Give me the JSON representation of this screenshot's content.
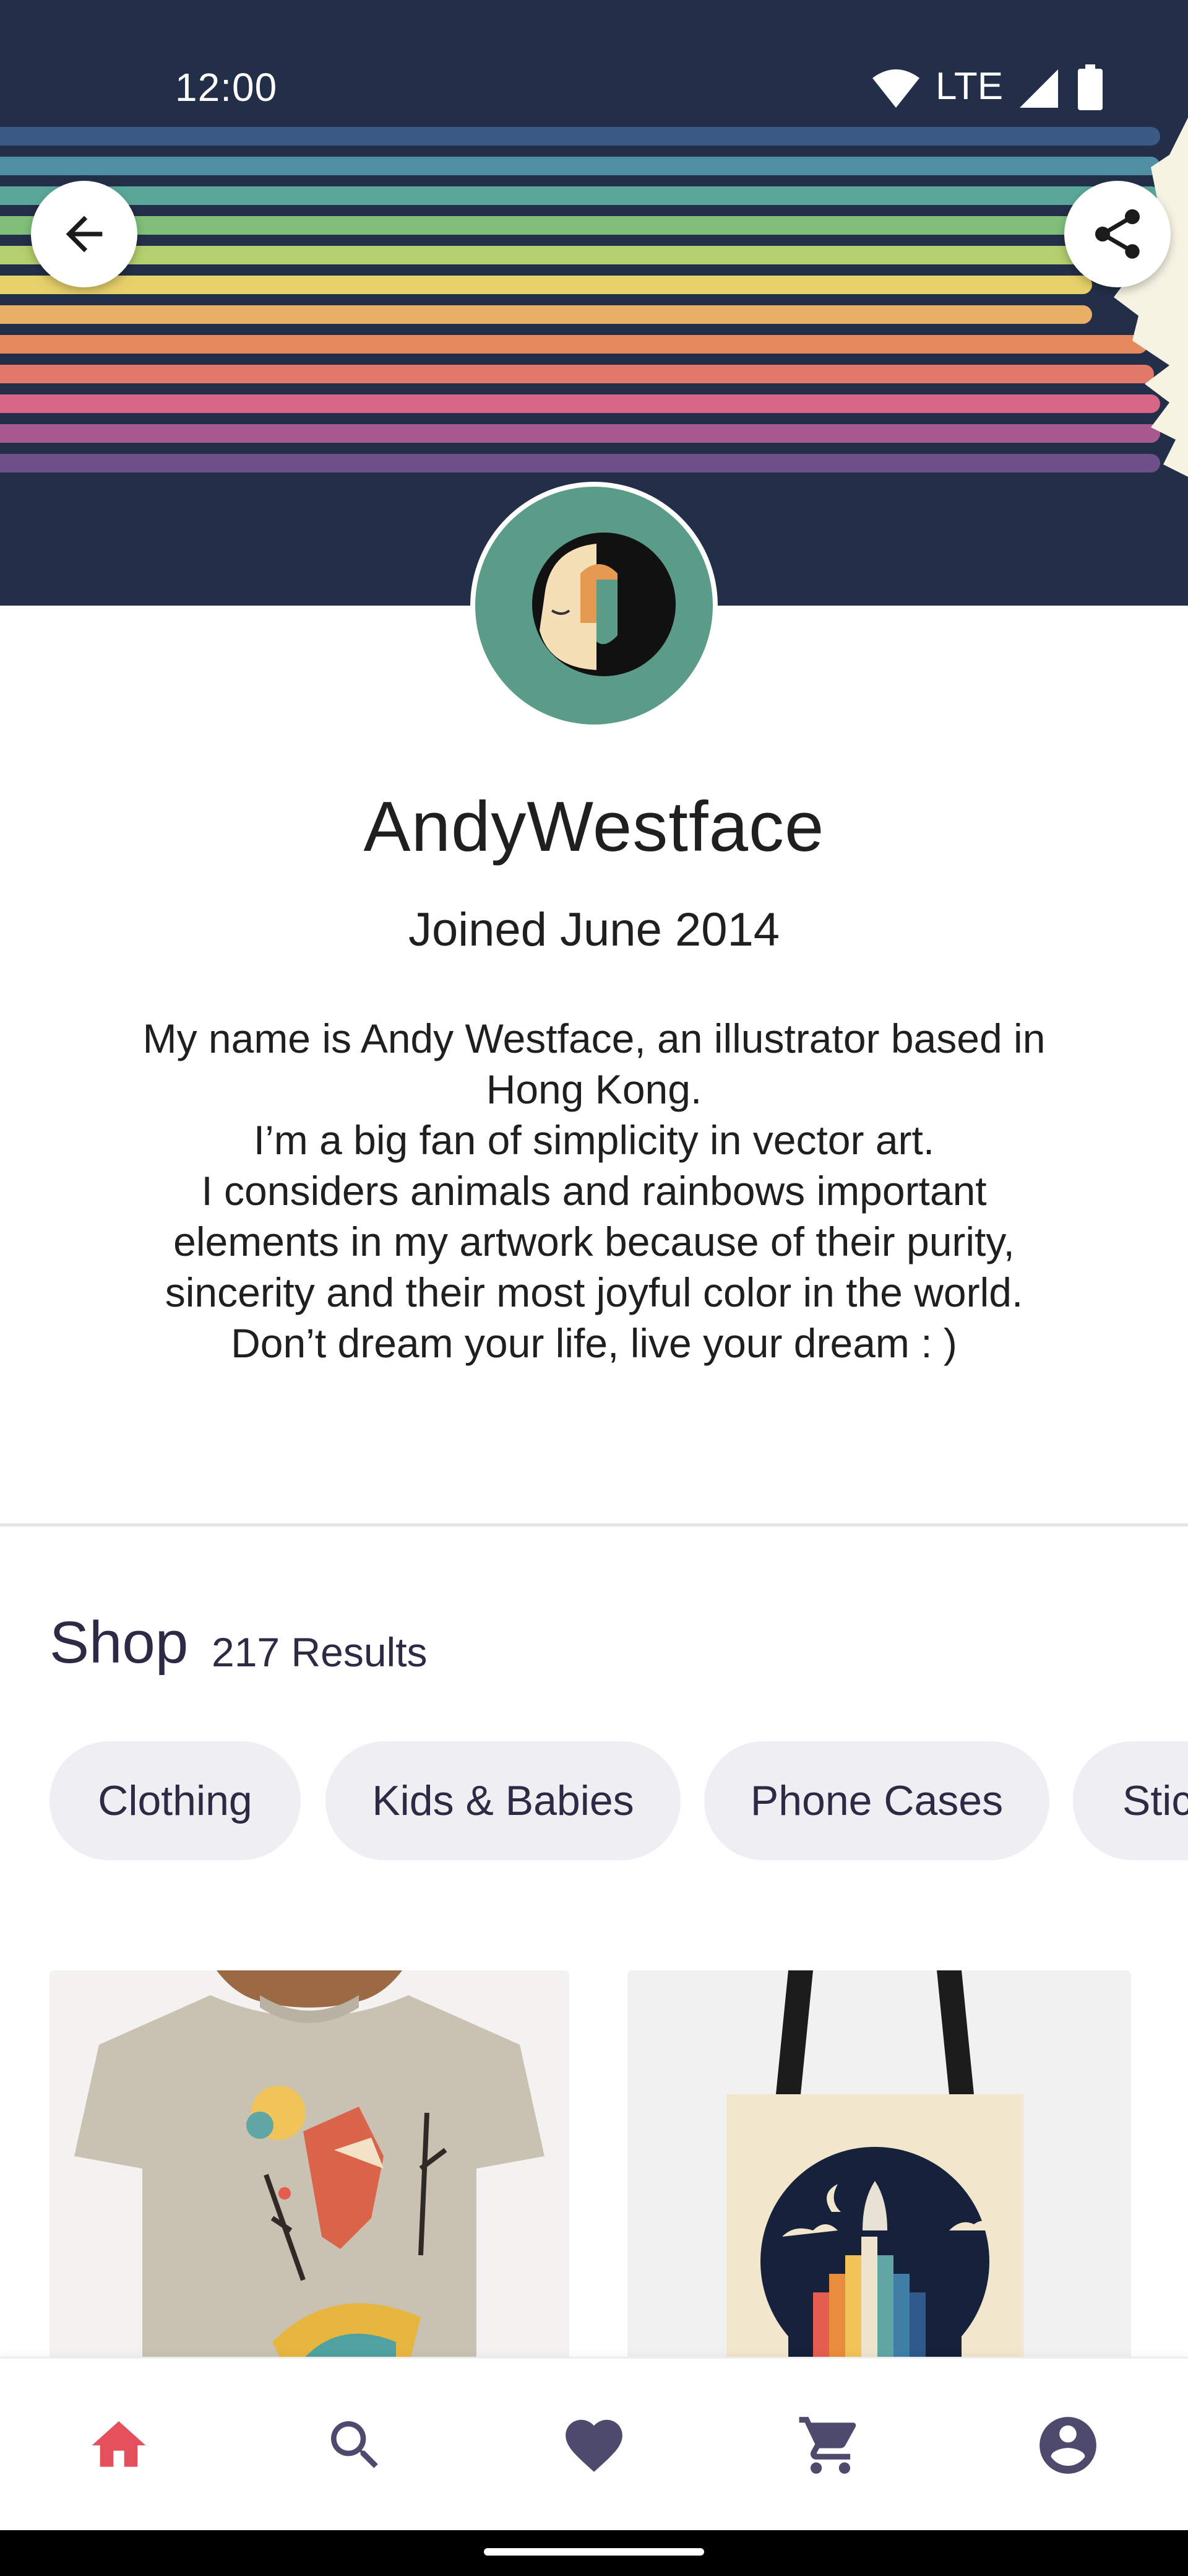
{
  "status_bar": {
    "time": "12:00",
    "network": "LTE",
    "icons": [
      "wifi-icon",
      "signal-icon",
      "battery-icon"
    ]
  },
  "header": {
    "back_icon": "arrow-back-icon",
    "share_icon": "share-icon",
    "banner_colors": [
      "#3b5a86",
      "#4f8ea3",
      "#5aa79a",
      "#7fbf7a",
      "#b4cf6e",
      "#e6d06a",
      "#e7b066",
      "#e48a5e",
      "#e2786a",
      "#d86787",
      "#a85a90",
      "#6e4f8a"
    ]
  },
  "profile": {
    "username": "AndyWestface",
    "joined": "Joined June 2014",
    "bio_lines": [
      "My name is Andy Westface, an illustrator based in",
      "Hong Kong.",
      "I’m a big fan of simplicity in vector art.",
      "I considers animals and rainbows important",
      "elements in my artwork because of their purity,",
      "sincerity and their most joyful color in the world.",
      "Don’t dream your life, live your dream : )"
    ]
  },
  "shop": {
    "title": "Shop",
    "count": "217 Results",
    "chips": [
      "Clothing",
      "Kids & Babies",
      "Phone Cases",
      "Stic"
    ]
  },
  "products": [
    {
      "name": "fox-tshirt-image"
    },
    {
      "name": "rocket-tote-bag-image"
    }
  ],
  "bottom_nav": {
    "items": [
      {
        "icon": "home-icon",
        "active": true
      },
      {
        "icon": "search-icon",
        "active": false
      },
      {
        "icon": "heart-icon",
        "active": false
      },
      {
        "icon": "cart-icon",
        "active": false
      },
      {
        "icon": "account-icon",
        "active": false
      }
    ],
    "active_color": "#e4505c",
    "inactive_color": "#4e4a6e"
  }
}
